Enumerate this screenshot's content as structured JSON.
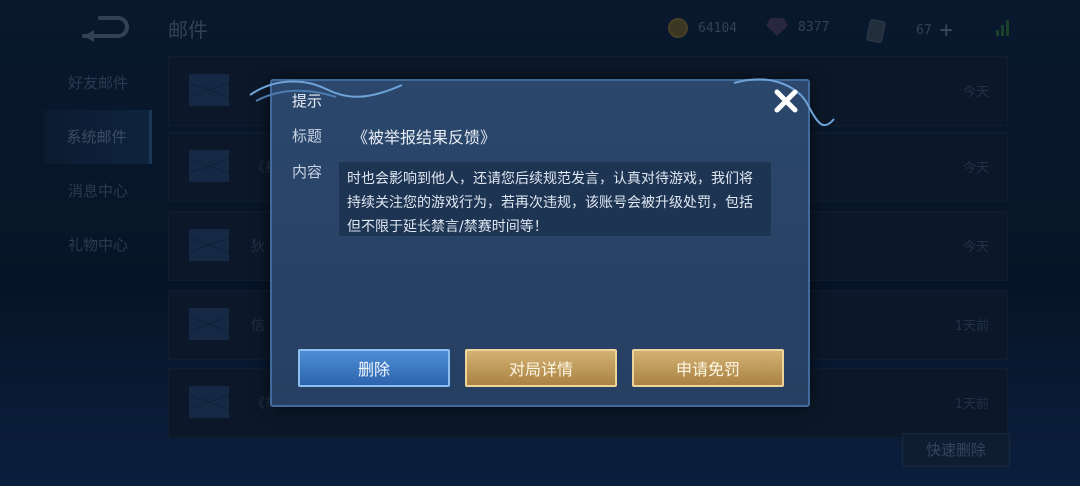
{
  "header": {
    "title": "邮件",
    "resources": [
      {
        "icon": "gold-coin-icon",
        "value": "64104"
      },
      {
        "icon": "gem-icon",
        "value": "8377"
      },
      {
        "icon": "card-icon",
        "value": "67"
      }
    ]
  },
  "sidebar": {
    "items": [
      {
        "label": "好友邮件",
        "active": false
      },
      {
        "label": "系统邮件",
        "active": true
      },
      {
        "label": "消息中心",
        "active": false
      },
      {
        "label": "礼物中心",
        "active": false
      }
    ]
  },
  "mail_list": [
    {
      "title": "",
      "time": "今天"
    },
    {
      "title": "《被",
      "time": "今天"
    },
    {
      "title": "狄",
      "time": "今天"
    },
    {
      "title": "信",
      "time": "1天前"
    },
    {
      "title": "《举",
      "time": "1天前"
    }
  ],
  "quick_delete_label": "快速删除",
  "dialog": {
    "header": "提示",
    "subject_label": "标题",
    "subject": "《被举报结果反馈》",
    "content_label": "内容",
    "content": "时也会影响到他人，还请您后续规范发言，认真对待游戏，我们将持续关注您的游戏行为，若再次违规，该账号会被升级处罚，包括但不限于延长禁言/禁赛时间等！",
    "buttons": {
      "delete": "删除",
      "match_details": "对局详情",
      "appeal": "申请免罚"
    }
  },
  "colors": {
    "dialog_bg": "#2b476c",
    "button_blue": "#3d7cc6",
    "button_gold": "#c4a15e"
  }
}
